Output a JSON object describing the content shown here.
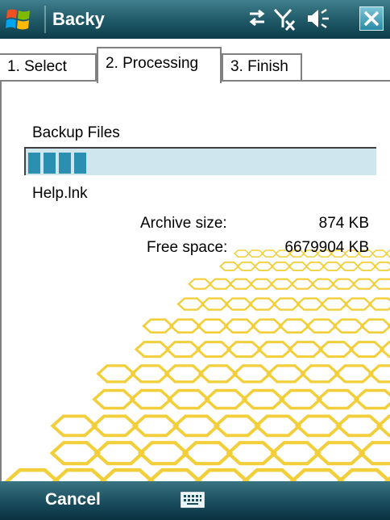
{
  "titlebar": {
    "app_title": "Backy",
    "icons": [
      "windows-start-icon",
      "connectivity-icon",
      "signal-off-icon",
      "volume-icon",
      "close-icon"
    ]
  },
  "tabs": [
    {
      "label": "1. Select",
      "active": false
    },
    {
      "label": "2. Processing",
      "active": true
    },
    {
      "label": "3. Finish",
      "active": false
    }
  ],
  "processing": {
    "task_label": "Backup Files",
    "progress_fraction": 0.15,
    "current_file": "Help.lnk",
    "archive_size_label": "Archive size:",
    "archive_size_value": "874 KB",
    "free_space_label": "Free space:",
    "free_space_value": "6679904 KB"
  },
  "menubar": {
    "left_softkey": "Cancel",
    "input_icon": "keyboard-icon"
  },
  "colors": {
    "titlebar": "#1f5866",
    "progress_fill": "#2a8fb0",
    "progress_track": "#cfe6ee",
    "honeycomb": "#f2cf3a"
  }
}
